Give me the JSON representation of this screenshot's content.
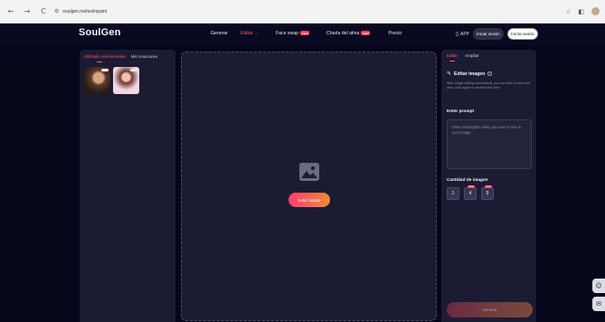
{
  "browser": {
    "url": "soulgen.net/es/inpaint",
    "back": "←",
    "forward": "→",
    "reload": "C"
  },
  "header": {
    "logo": "SoulGen",
    "nav": [
      {
        "label": "Generar",
        "active": false,
        "badge": ""
      },
      {
        "label": "Editar",
        "active": true,
        "badge": ""
      },
      {
        "label": "Face swap",
        "active": false,
        "badge": "NEW"
      },
      {
        "label": "Charla del alma",
        "active": false,
        "badge": "NEW"
      },
      {
        "label": "Precio",
        "active": false,
        "badge": ""
      }
    ],
    "app_label": "APP",
    "login_label": "Iniciar sesión",
    "logout_label": "Cerrar sesión"
  },
  "left_panel": {
    "tabs": [
      "Utilizado recientemente",
      "Mis creaciones"
    ]
  },
  "canvas": {
    "upload_label": "Subir imagen"
  },
  "right_panel": {
    "tabs": [
      "Editar",
      "Ampliar"
    ],
    "section_title": "Editar imagen",
    "help_text": "After image editing successfully, you can click to select an area, click again to deselect the area.",
    "prompt_label": "Enter prompt",
    "prompt_placeholder": "Enter description what you want to see in your image",
    "qty_label": "Cantidad de imagen",
    "quantities": [
      "1",
      "4",
      "9"
    ],
    "pro_badge": "PRO",
    "generate_label": "Generar"
  },
  "colors": {
    "accent": "#ff5a6e",
    "background": "#05061a",
    "panel": "#1b1c33"
  }
}
